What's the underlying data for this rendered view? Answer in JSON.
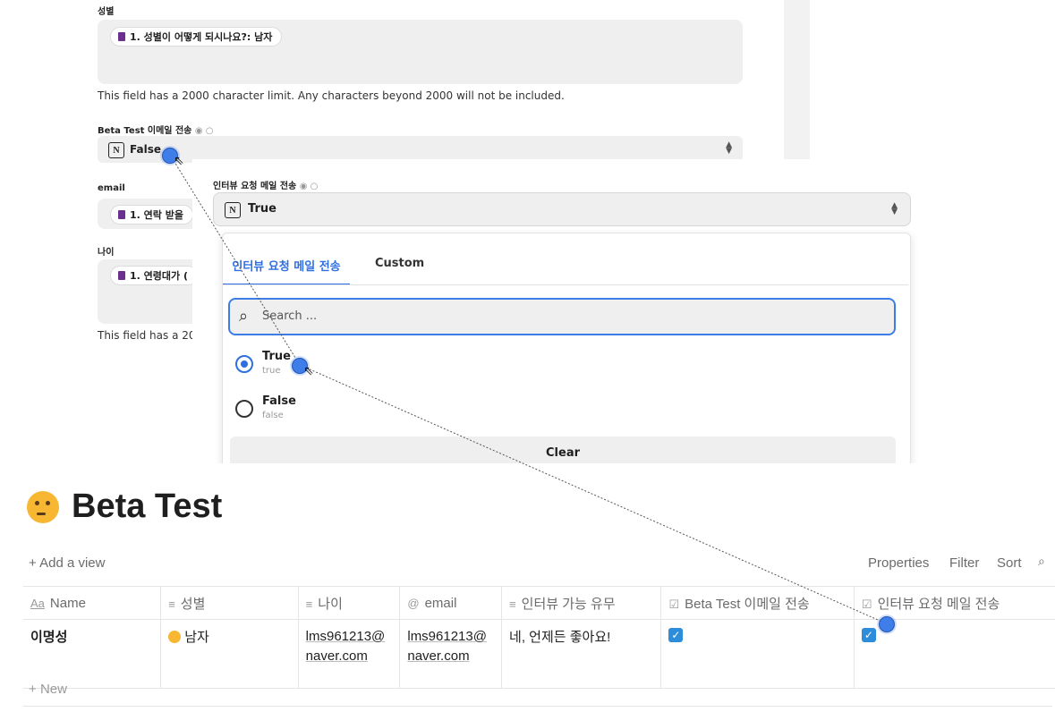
{
  "form": {
    "gender_label": "성별",
    "gender_pill": "1. 성별이 어떻게 되시나요?:  남자",
    "limit_note": "This field has a 2000 character limit. Any characters beyond 2000 will not be included.",
    "beta_label": "Beta Test 이메일 전송",
    "beta_value": "False",
    "email_label": "email",
    "email_pill": "1. 연락 받을",
    "age_label": "나이",
    "age_pill": "1. 연령대가 (",
    "limit_note_short": "This field has a 20",
    "notion_badge": "N"
  },
  "popup": {
    "label": "인터뷰 요청 메일 전송",
    "selected_value": "True",
    "tabs": [
      "인터뷰 요청 메일 전송",
      "Custom"
    ],
    "search_placeholder": "Search ...",
    "options": [
      {
        "label": "True",
        "sub": "true",
        "selected": true
      },
      {
        "label": "False",
        "sub": "false",
        "selected": false
      }
    ],
    "clear_label": "Clear"
  },
  "notion": {
    "title": "Beta Test",
    "add_view": "Add a view",
    "toolbar": [
      "Properties",
      "Filter",
      "Sort"
    ],
    "columns": [
      "Name",
      "성별",
      "나이",
      "email",
      "인터뷰 가능 유무",
      "Beta Test 이메일 전송",
      "인터뷰 요청 메일 전송"
    ],
    "row": {
      "name": "이명성",
      "gender": "남자",
      "age_line1": "lms961213@",
      "age_line2": "naver.com",
      "email_line1": "lms961213@",
      "email_line2": "naver.com",
      "interview": "네, 언제든 좋아요!",
      "beta_checked": true,
      "interview_checked": true
    },
    "new_label": "New"
  },
  "colors": {
    "accent": "#2e8ddb",
    "pointer": "#3f7ee8",
    "tab_active": "#2f6fe0"
  }
}
